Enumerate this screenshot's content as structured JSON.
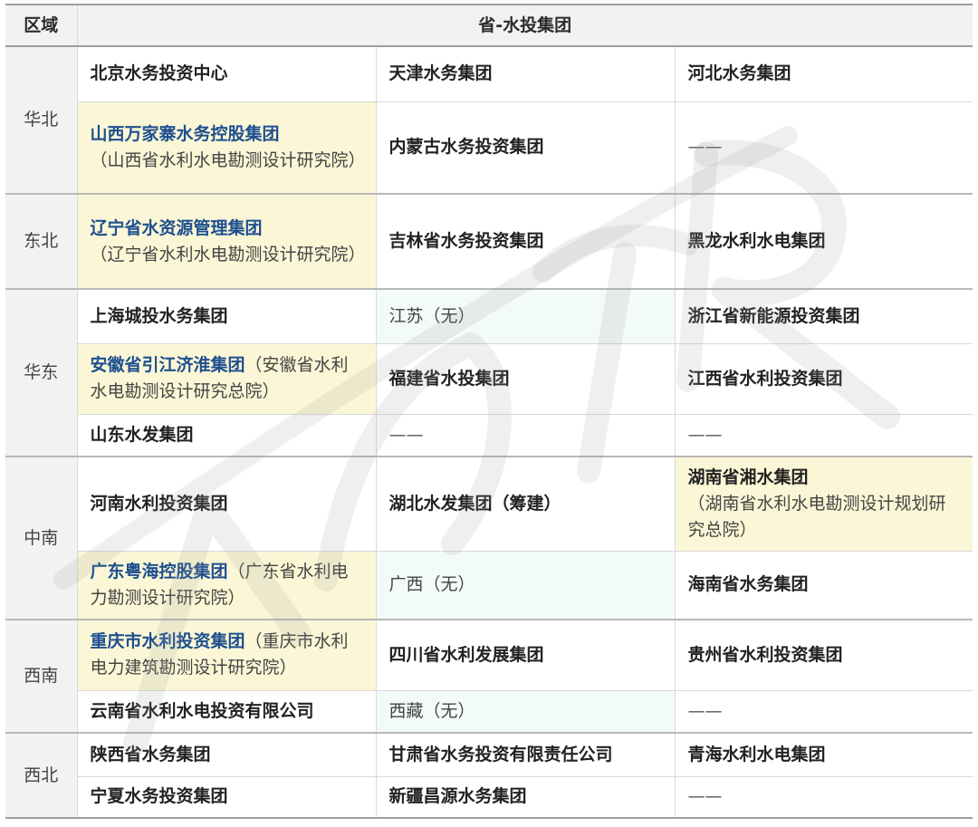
{
  "header": {
    "region": "区域",
    "group": "省-水投集团"
  },
  "rows": [
    {
      "region": "华北",
      "cells": [
        {
          "text": "北京水务投资中心"
        },
        {
          "text": "天津水务集团"
        },
        {
          "text": "河北水务集团"
        }
      ]
    },
    {
      "cells": [
        {
          "text": "山西万家寨水务控股集团",
          "note": "（山西省水利水电勘测设计研究院）"
        },
        {
          "text": "内蒙古水务投资集团"
        },
        {
          "text": "——"
        }
      ]
    },
    {
      "region": "东北",
      "cells": [
        {
          "text": "辽宁省水资源管理集团",
          "note": "（辽宁省水利水电勘测设计研究院）"
        },
        {
          "text": "吉林省水务投资集团"
        },
        {
          "text": "黑龙水利水电集团"
        }
      ]
    },
    {
      "region": "华东",
      "cells": [
        {
          "text": "上海城投水务集团"
        },
        {
          "text": "江苏（无）"
        },
        {
          "text": "浙江省新能源投资集团"
        }
      ]
    },
    {
      "cells": [
        {
          "text": "安徽省引江济淮集团",
          "note": "（安徽省水利水电勘测设计研究总院）"
        },
        {
          "text": "福建省水投集团"
        },
        {
          "text": "江西省水利投资集团"
        }
      ]
    },
    {
      "cells": [
        {
          "text": "山东水发集团"
        },
        {
          "text": "——"
        },
        {
          "text": "——"
        }
      ]
    },
    {
      "region": "中南",
      "cells": [
        {
          "text": "河南水利投资集团"
        },
        {
          "text": "湖北水发集团（筹建）"
        },
        {
          "text": "湖南省湘水集团",
          "note": "（湖南省水利水电勘测设计规划研究总院）"
        }
      ]
    },
    {
      "cells": [
        {
          "text": "广东粤海控股集团",
          "note": "（广东省水利电力勘测设计研究院）"
        },
        {
          "text": "广西（无）"
        },
        {
          "text": "海南省水务集团"
        }
      ]
    },
    {
      "region": "西南",
      "cells": [
        {
          "text": "重庆市水利投资集团",
          "note": "（重庆市水利电力建筑勘测设计研究院）"
        },
        {
          "text": "四川省水利发展集团"
        },
        {
          "text": "贵州省水利投资集团"
        }
      ]
    },
    {
      "cells": [
        {
          "text": "云南省水利水电投资有限公司"
        },
        {
          "text": "西藏（无）"
        },
        {
          "text": "——"
        }
      ]
    },
    {
      "region": "西北",
      "cells": [
        {
          "text": "陕西省水务集团"
        },
        {
          "text": "甘肃省水务投资有限责任公司"
        },
        {
          "text": "青海水利水电集团"
        }
      ]
    },
    {
      "cells": [
        {
          "text": "宁夏水务投资集团"
        },
        {
          "text": "新疆昌源水务集团"
        },
        {
          "text": "——"
        }
      ]
    }
  ]
}
